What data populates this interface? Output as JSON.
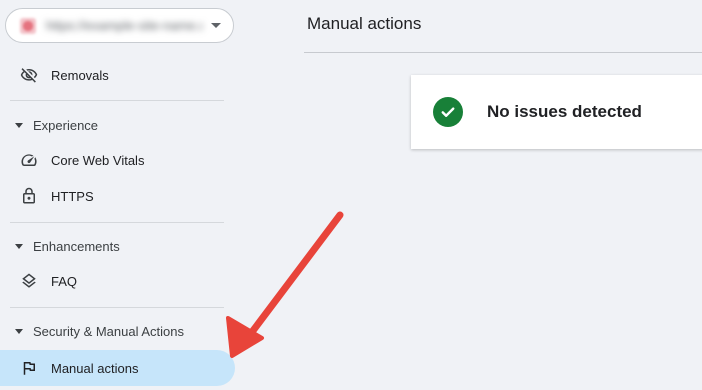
{
  "sidebar": {
    "property": {
      "url_blurred": "https://example-site-name.com/",
      "caret_icon": "arrow-drop-down-icon"
    },
    "items": [
      {
        "label": "Removals",
        "icon": "visibility-off-icon"
      },
      {
        "label": "Core Web Vitals",
        "icon": "speed-gauge-icon"
      },
      {
        "label": "HTTPS",
        "icon": "lock-icon"
      },
      {
        "label": "FAQ",
        "icon": "layers-icon"
      },
      {
        "label": "Manual actions",
        "icon": "flag-icon",
        "active": true
      }
    ],
    "sections": [
      {
        "label": "Experience"
      },
      {
        "label": "Enhancements"
      },
      {
        "label": "Security & Manual Actions"
      }
    ]
  },
  "main": {
    "title": "Manual actions",
    "status": {
      "text": "No issues detected",
      "icon": "check-circle-icon",
      "color": "#188038"
    }
  },
  "annotation": {
    "arrow_color": "#e8443a"
  },
  "colors": {
    "active_bg": "#c6e5fa",
    "page_bg": "#f0f2f6"
  }
}
